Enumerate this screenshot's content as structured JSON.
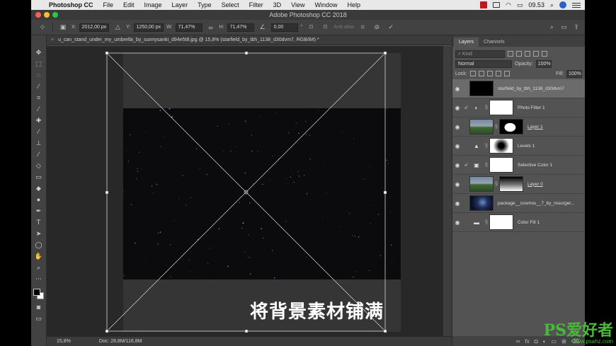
{
  "menubar": {
    "app": "Photoshop CC",
    "items": [
      "File",
      "Edit",
      "Image",
      "Layer",
      "Type",
      "Select",
      "Filter",
      "3D",
      "View",
      "Window",
      "Help"
    ],
    "clock": "09.53"
  },
  "window": {
    "title": "Adobe Photoshop CC 2018"
  },
  "options": {
    "x_label": "X:",
    "x_value": "2012,00 px",
    "y_label": "Y:",
    "y_value": "1250,00 px",
    "w_label": "W:",
    "w_value": "71,47%",
    "h_label": "H:",
    "h_value": "71,47%",
    "angle_value": "0,00",
    "degree": "°",
    "antialias": "Anti-alias"
  },
  "document": {
    "tab_title": "u_can_stand_under_my_umbrella_by_sunnysanki_d94e5t8.jpg @ 15,8% (starfield_by_tbh_1138_d30dvm7, RGB/8#) *",
    "caption": "将背景素材铺满"
  },
  "status": {
    "zoom": "15,8%",
    "doc": "Doc: 28,8M/116,8M"
  },
  "panel": {
    "tabs": [
      "Layers",
      "Channels"
    ],
    "kind": "Kind",
    "blend_mode": "Normal",
    "opacity_label": "Opacity:",
    "opacity_value": "100%",
    "lock_label": "Lock:",
    "fill_label": "Fill:",
    "fill_value": "100%",
    "layers": [
      {
        "name": "starfield_by_tbh_1138_d30dvm7",
        "selected": true
      },
      {
        "name": "Photo Filter 1"
      },
      {
        "name": "Layer 1"
      },
      {
        "name": "Levels 1"
      },
      {
        "name": "Selective Color 1"
      },
      {
        "name": "Layer 0"
      },
      {
        "name": "package__cosmos__7_by_resurger..."
      },
      {
        "name": "Color Fill 1"
      }
    ]
  },
  "watermark": {
    "big": "PS爱好者",
    "small": "www.psahz.com"
  }
}
